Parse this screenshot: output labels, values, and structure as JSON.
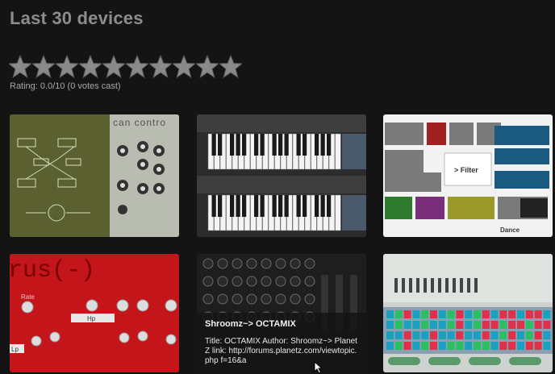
{
  "page": {
    "title": "Last 30 devices"
  },
  "rating": {
    "text": "Rating: 0.0/10 (0 votes cast)",
    "value": 0,
    "max": 10
  },
  "thumbs": [
    {
      "caption": "can contro"
    },
    {
      "caption": ""
    },
    {
      "caption": "> Filter",
      "footer": "Dance"
    },
    {
      "caption": "rus(-)",
      "label_rate": "Rate",
      "label_hp": "Hp",
      "label_lp": "Lp"
    },
    {
      "caption": ""
    },
    {
      "caption": ""
    }
  ],
  "tooltip": {
    "title": "Shroomz~> OCTAMIX",
    "body": "Title: OCTAMIX Author: Shroomz~> Planet Z link: http://forums.planetz.com/viewtopic.php f=16&a"
  },
  "colors": {
    "background": "#141414",
    "star": "#8a8a8a",
    "title": "#8c8c8c"
  }
}
